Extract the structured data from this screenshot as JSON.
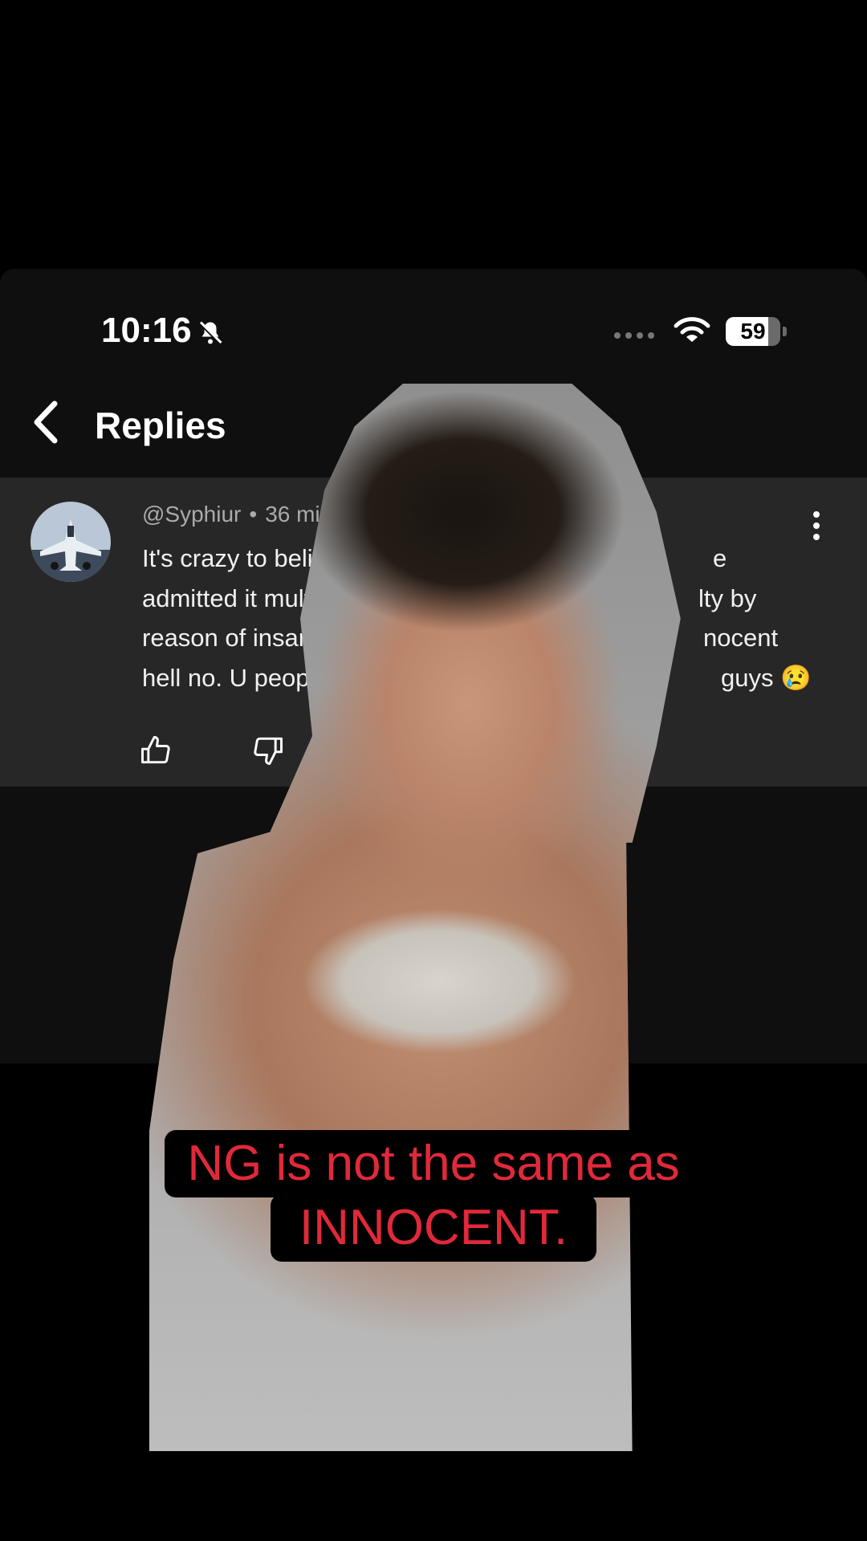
{
  "status_bar": {
    "time": "10:16",
    "battery": "59"
  },
  "header": {
    "title": "Replies"
  },
  "comment": {
    "username": "@Syphiur",
    "age": "36 minute",
    "lines": [
      "It's crazy to believ",
      "admitted it multip",
      "reason of insanity",
      "hell no. U people"
    ],
    "right_fragments": [
      "e",
      "lty by",
      "nocent",
      "guys"
    ],
    "emoji": "😢"
  },
  "caption": {
    "line1": "NG is not the same as",
    "line2": "INNOCENT."
  },
  "icons": {
    "back": "chevron-left-icon",
    "bell": "bell-slash-icon",
    "wifi": "wifi-icon",
    "more": "more-vertical-icon",
    "like": "thumb-up-icon",
    "dislike": "thumb-down-icon",
    "reply": "reply-icon"
  },
  "colors": {
    "card_bg": "#272727",
    "caption_text": "#e0293a"
  }
}
